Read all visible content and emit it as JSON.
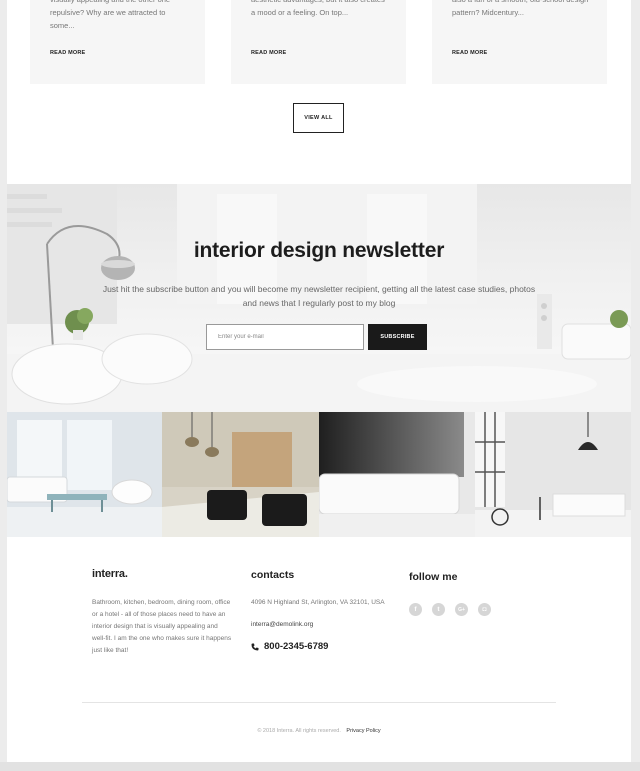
{
  "cards": [
    {
      "text": "visually appealing and the other one repulsive? Why are we attracted to some...",
      "more": "READ MORE"
    },
    {
      "text": "aesthetic advantages, but it also creates a mood or a feeling. On top...",
      "more": "READ MORE"
    },
    {
      "text": "also a fan of a smooth, old-school design pattern? Midcentury...",
      "more": "READ MORE"
    }
  ],
  "view_all": "VIEW ALL",
  "newsletter": {
    "title": "interior design newsletter",
    "description": "Just hit the subscribe button and you will become my newsletter recipient, getting all the latest case studies, photos and news that I regularly post to my blog",
    "placeholder": "Enter your e-mail",
    "button": "SUBSCRIBE"
  },
  "footer": {
    "logo": "interra.",
    "about": "Bathroom, kitchen, bedroom, dining room, office or a hotel - all of those places need to have an interior design that is visually appealing and well-fit. I am the one who makes sure it happens just like that!",
    "contacts_title": "contacts",
    "address": "4096 N Highland St, Arlington, VA 32101, USA",
    "email": "interra@demolink.org",
    "phone": "800-2345-6789",
    "follow_title": "follow me",
    "socials": [
      {
        "icon": "facebook-icon",
        "glyph": "f"
      },
      {
        "icon": "twitter-icon",
        "glyph": "t"
      },
      {
        "icon": "google-plus-icon",
        "glyph": "G+"
      },
      {
        "icon": "instagram-icon",
        "glyph": "◘"
      }
    ],
    "copyright": "© 2018 Interra. All rights reserved.",
    "privacy": "Privacy Policy"
  },
  "colors": {
    "accent": "#1a1a1a",
    "social": "#d6d6d6",
    "card_bg": "#f6f6f6"
  }
}
